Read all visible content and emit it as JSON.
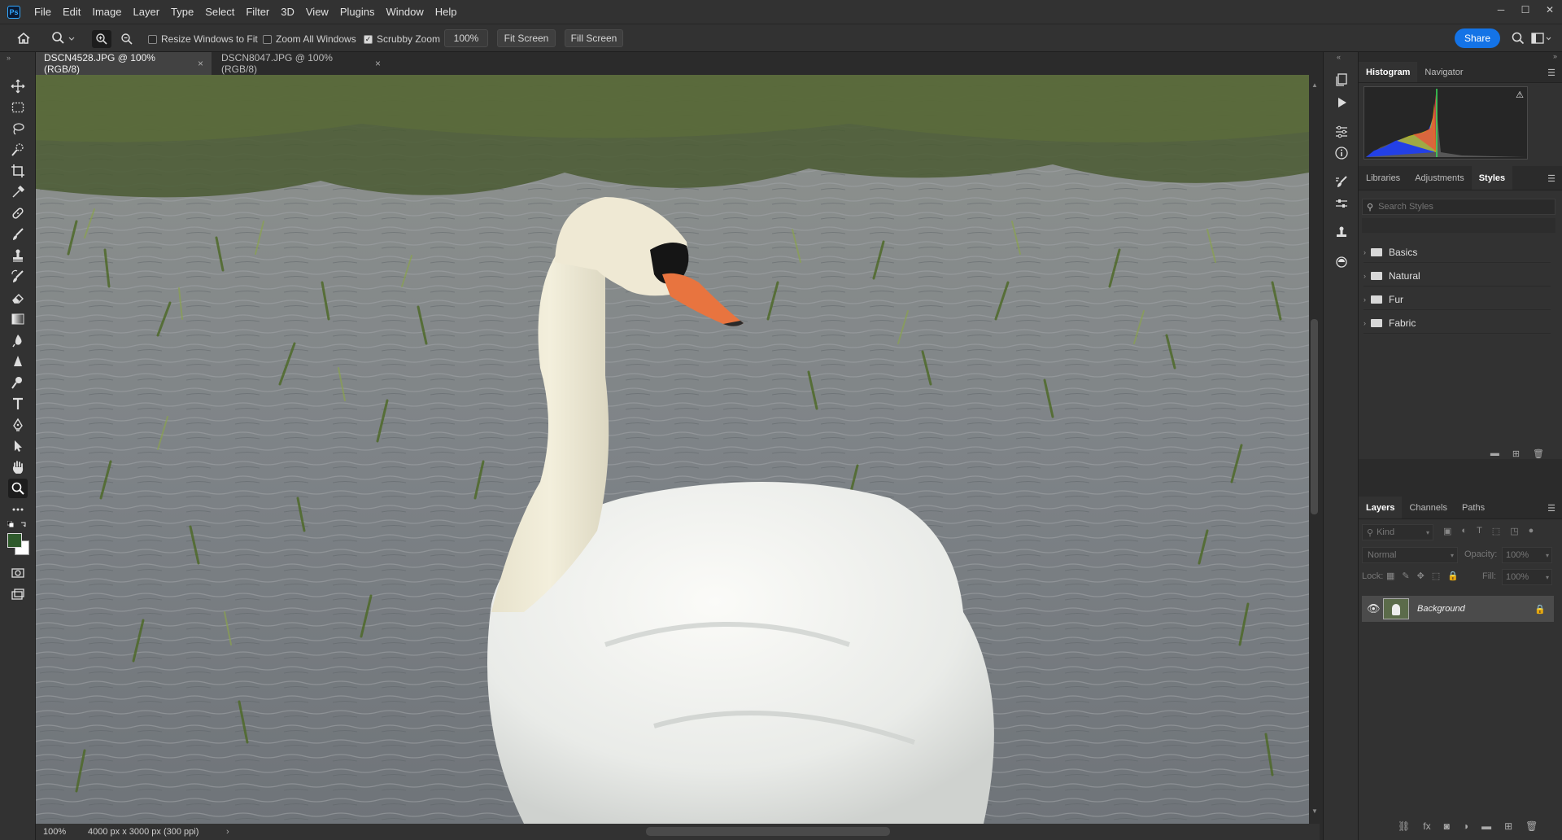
{
  "app": {
    "logo_text": "Ps"
  },
  "menu": [
    "File",
    "Edit",
    "Image",
    "Layer",
    "Type",
    "Select",
    "Filter",
    "3D",
    "View",
    "Plugins",
    "Window",
    "Help"
  ],
  "window_controls": {
    "minimize": "─",
    "maximize": "☐",
    "close": "✕"
  },
  "options_bar": {
    "resize_windows_label": "Resize Windows to Fit",
    "resize_windows_checked": false,
    "zoom_all_label": "Zoom All Windows",
    "zoom_all_checked": false,
    "scrubby_zoom_label": "Scrubby Zoom",
    "scrubby_zoom_checked": true,
    "zoom_value": "100%",
    "fit_screen_label": "Fit Screen",
    "fill_screen_label": "Fill Screen",
    "share_label": "Share"
  },
  "tabs": [
    {
      "title": "DSCN4528.JPG @ 100% (RGB/8)",
      "close": "×",
      "active": true
    },
    {
      "title": "DSCN8047.JPG @ 100% (RGB/8)",
      "close": "×",
      "active": false
    }
  ],
  "status": {
    "zoom": "100%",
    "doc_info": "4000 px x 3000 px (300 ppi)",
    "arrow": "›"
  },
  "panels": {
    "top_tabs": [
      "Histogram",
      "Navigator"
    ],
    "styles_tabs": [
      "Libraries",
      "Adjustments",
      "Styles"
    ],
    "search_placeholder": "Search Styles",
    "style_folders": [
      "Basics",
      "Natural",
      "Fur",
      "Fabric"
    ],
    "layers_tabs": [
      "Layers",
      "Channels",
      "Paths"
    ],
    "kind_label": "Kind",
    "blend_mode": "Normal",
    "opacity_label": "Opacity:",
    "opacity_value": "100%",
    "lock_label": "Lock:",
    "fill_label": "Fill:",
    "fill_value": "100%",
    "layers": [
      {
        "name": "Background",
        "visible": true,
        "locked": true
      }
    ]
  },
  "colors": {
    "accent": "#1473e6",
    "panel_bg": "#323232",
    "dark_bg": "#2b2b2b",
    "foreground_color": "#2f5a2c",
    "background_color": "#ffffff"
  },
  "icons": {
    "toolbar": [
      "move-icon",
      "marquee-icon",
      "lasso-icon",
      "quick-select-icon",
      "crop-icon",
      "eyedropper-icon",
      "healing-icon",
      "brush-icon",
      "stamp-icon",
      "history-brush-icon",
      "eraser-icon",
      "gradient-icon",
      "blur-icon",
      "dodge-icon",
      "pen-icon",
      "type-icon",
      "path-select-icon",
      "shape-icon",
      "hand-icon",
      "zoom-icon",
      "more-icon"
    ]
  }
}
